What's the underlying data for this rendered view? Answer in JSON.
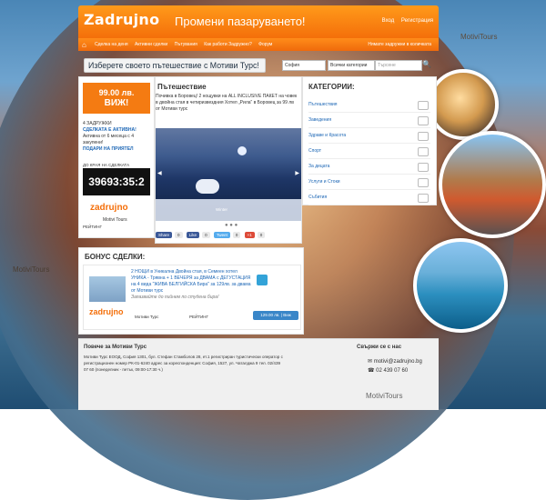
{
  "brand": {
    "logo_text": "Zadrujno",
    "tagline": "Промени пазаруването!",
    "login": "Вход",
    "register": "Регистрация"
  },
  "nav": {
    "items": [
      "Сделка на деня",
      "Активни сделки",
      "Пътувания",
      "Как работи Задружно?",
      "Форум"
    ],
    "right": "Нямате задружни в количката"
  },
  "search": {
    "title": "Изберете своето пътешествие с Мотиви Турс!",
    "city": "София",
    "category": "Всички категории",
    "placeholder": "Търсене"
  },
  "offer": {
    "price": "99.00 лв.",
    "cta": "ВИЖ!",
    "joins_label": "4 ЗАДРУЖКИ",
    "active_label": "СДЕЛКАТА Е АКТИВНА!",
    "active_note": "Активна от 6 месеца с 4 закупени!",
    "gift": "ПОДАРИ НА ПРИЯТЕЛ",
    "timer_label": "ДО КРАЯ НА СДЕЛКАТА ОСТАВАТ:",
    "timer": "39693:35:2",
    "seller": "Motivi Tours",
    "rating_label": "РЕЙТИНГ"
  },
  "deal": {
    "title": "Пътешествие",
    "description": "Почивка в Боровец! 2 нощувки на ALL INCLUSIVE ПАКЕТ на човек в двойна стая в четиризвездния Хотел „Рила“ в Боровец за 99 лв от Мотиви турс",
    "image_caption": "Winter",
    "share": {
      "fb": "Share",
      "fb_count": "0",
      "like": "Like",
      "like_count": "0",
      "tweet": "Tweet",
      "tweet_count": "0",
      "g": "+1",
      "g_count": "0"
    }
  },
  "categories": {
    "title": "КАТЕГОРИИ:",
    "items": [
      "Пътешествия",
      "Заведения",
      "Здраве и Красота",
      "Спорт",
      "За децата",
      "Услуги и Стоки",
      "Събития"
    ]
  },
  "bonus": {
    "title": "БОНУС СДЕЛКИ:",
    "text": "2 НОЩИ в Уникална Двойна стая, в Семеен хотел УНИКА - Трявна + 1 ВЕЧЕРЯ за ДВАМА с ДЕГУСТАЦИЯ на 4 вида \"ЖИВА БЕЛГИЙСКА Бира\" за 129лв. за двама от Мотиви турс",
    "sub": "Запазвайте до пийнем по студена бира!",
    "seller": "Мотиви Турс",
    "rating_label": "РЕЙТИНГ",
    "button": "129.00 лв. | Виж"
  },
  "footer": {
    "title": "Повече за Мотиви Турс",
    "address": "Мотиви Турс ЕООД, София 1301, бул. Стефан Стамболов 28, ет.1 регистриран туристически оператор с регистрационен номер РК-01-6240 адрес за кореспонденция: София, 1527, ул. Чаталджа 9 тел. 02/439 07 60 (понеделник - петък, 09:00-17:30 ч.)",
    "contact_title": "Свържи се с нас",
    "email": "motivi@zadrujno.bg",
    "phone": "02 439 07 60",
    "logo": "MotiviTours"
  },
  "side": {
    "right_logo": "MotiviTours",
    "left_logo": "MotiviTours"
  }
}
